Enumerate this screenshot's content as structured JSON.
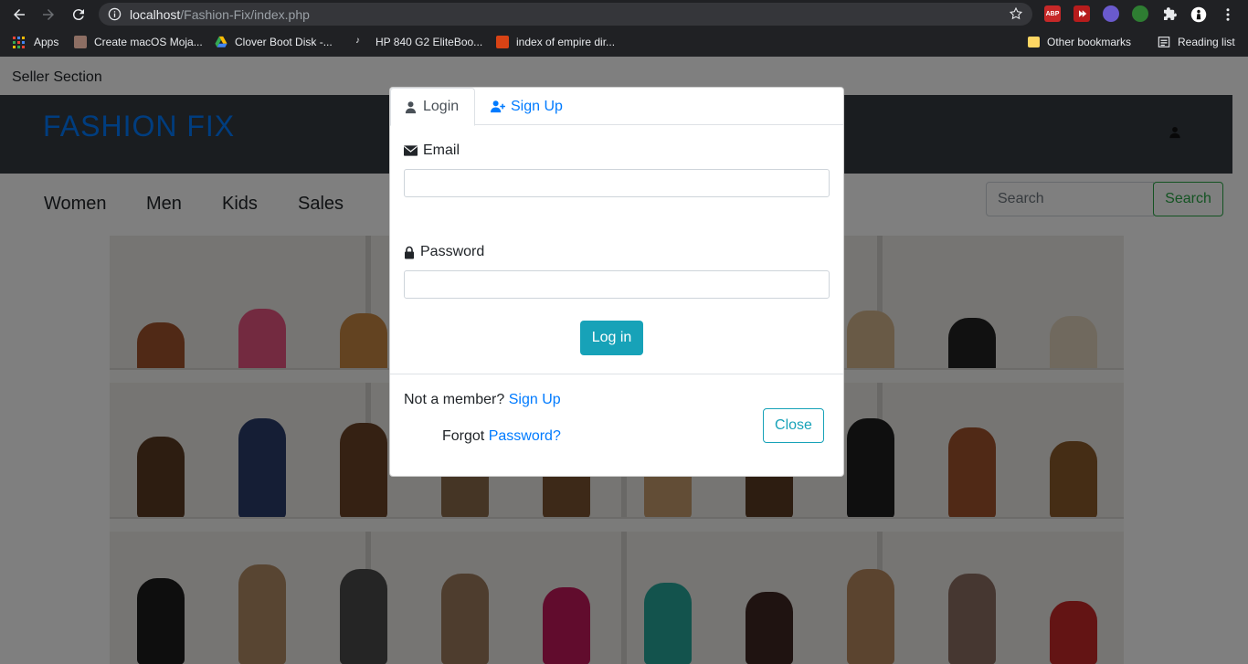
{
  "browser": {
    "url_host": "localhost",
    "url_path": "/Fashion-Fix/index.php",
    "extensions": [
      "ABP"
    ],
    "bookmarks": [
      "Apps",
      "Create macOS Moja...",
      "Clover Boot Disk -...",
      "HP 840 G2 EliteBoo...",
      "index of empire dir...",
      "Other bookmarks",
      "Reading list"
    ]
  },
  "page": {
    "seller_section": "Seller Section",
    "brand": "FASHION FIX",
    "menu": [
      "Women",
      "Men",
      "Kids",
      "Sales"
    ],
    "search_placeholder": "Search",
    "search_button": "Search"
  },
  "modal": {
    "tab_login": "Login",
    "tab_signup": "Sign Up",
    "email_label": "Email",
    "password_label": "Password",
    "login_button": "Log in",
    "not_member_text": "Not a member?",
    "signup_link": "Sign Up",
    "forgot_text": "Forgot",
    "password_link": "Password?",
    "close_button": "Close"
  },
  "colors": {
    "brand_blue": "#007bff",
    "banner_dark": "#343a40",
    "info_teal": "#17a2b8",
    "success_green": "#28a745"
  }
}
